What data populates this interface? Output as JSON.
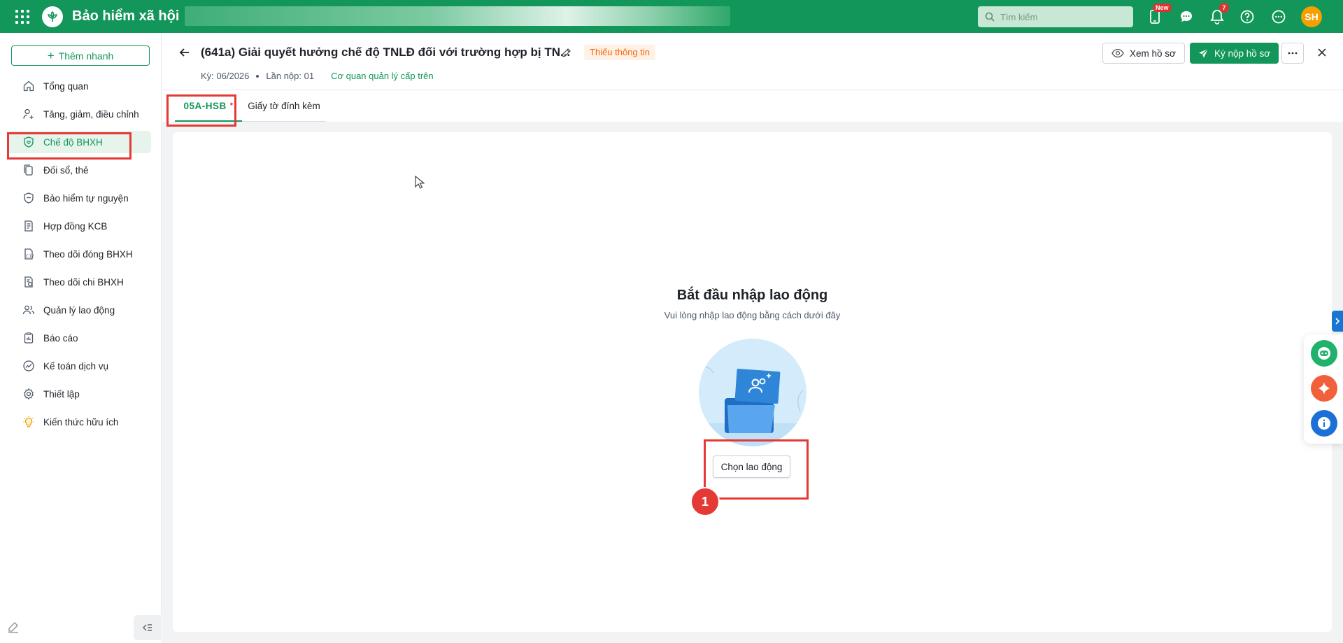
{
  "app": {
    "title": "Bảo hiểm xã hội"
  },
  "topbar": {
    "search_placeholder": "Tìm kiếm",
    "new_badge": "New",
    "notification_count": "7",
    "avatar_initials": "SH"
  },
  "sidebar": {
    "quick_add_label": "Thêm nhanh",
    "items": [
      {
        "label": "Tổng quan",
        "icon": "home-icon"
      },
      {
        "label": "Tăng, giảm, điều chỉnh",
        "icon": "user-edit-icon"
      },
      {
        "label": "Chế độ BHXH",
        "icon": "shield-heart-icon",
        "active": true
      },
      {
        "label": "Đối sổ, thẻ",
        "icon": "copy-icon"
      },
      {
        "label": "Bảo hiểm tự nguyện",
        "icon": "shield-icon"
      },
      {
        "label": "Hợp đồng KCB",
        "icon": "contract-icon"
      },
      {
        "label": "Theo dõi đóng BHXH",
        "icon": "c12-icon"
      },
      {
        "label": "Theo dõi chi BHXH",
        "icon": "doc-money-icon"
      },
      {
        "label": "Quản lý lao động",
        "icon": "users-icon"
      },
      {
        "label": "Báo cáo",
        "icon": "clipboard-icon"
      },
      {
        "label": "Kế toán dịch vụ",
        "icon": "chart-icon"
      },
      {
        "label": "Thiết lập",
        "icon": "gear-icon"
      },
      {
        "label": "Kiến thức hữu ích",
        "icon": "bulb-icon"
      }
    ]
  },
  "header": {
    "title": "(641a) Giải quyết hưởng chế độ TNLĐ đối với trường hợp bị TN...",
    "status": "Thiếu thông tin",
    "period": "Kỳ: 06/2026",
    "submission": "Lần nộp: 01",
    "agency": "Cơ quan quản lý cấp trên",
    "view_label": "Xem hồ sơ",
    "submit_label": "Ký nộp hồ sơ"
  },
  "tabs": [
    {
      "label": "05A-HSB",
      "required": "*",
      "active": true
    },
    {
      "label": "Giấy tờ đính kèm"
    }
  ],
  "empty_state": {
    "title": "Bắt đầu nhập lao động",
    "subtitle": "Vui lòng nhập lao động bằng cách dưới đây",
    "button": "Chọn lao động"
  },
  "annotation": {
    "step": "1"
  },
  "colors": {
    "brand": "#12965a",
    "annotation": "#e53935",
    "warning": "#f76707"
  }
}
